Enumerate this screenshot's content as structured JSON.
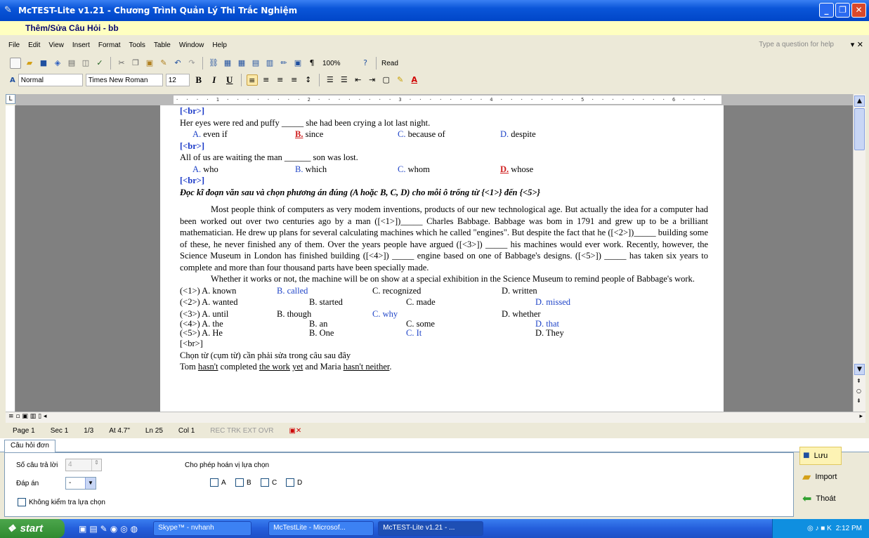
{
  "window": {
    "title": "McTEST-Lite v1.21 - Chương Trình Quản Lý Thi Trắc Nghiệm",
    "subheader": "Thêm/Sửa Câu Hỏi - bb"
  },
  "menu": [
    "File",
    "Edit",
    "View",
    "Insert",
    "Format",
    "Tools",
    "Table",
    "Window",
    "Help"
  ],
  "help_box": "Type a question for help",
  "toolbar": {
    "zoom": "100%",
    "read": "Read",
    "style": "Normal",
    "font": "Times New Roman",
    "size": "12"
  },
  "doc": {
    "br": "[<br>]",
    "q1_stem": "Her eyes were red and puffy _____ she had been crying a lot last night.",
    "q1_opts": [
      [
        "A.",
        "even if"
      ],
      [
        "B.",
        "since"
      ],
      [
        "C.",
        "because of"
      ],
      [
        "D.",
        "despite"
      ]
    ],
    "q2_stem": "All of us are waiting the man ______ son was lost.",
    "q2_opts": [
      [
        "A.",
        "who"
      ],
      [
        "B.",
        "which"
      ],
      [
        "C.",
        "whom"
      ],
      [
        "D.",
        "whose"
      ]
    ],
    "instruction": "Đọc kĩ đoạn văn sau và chọn phương án đúng  (A hoặc B, C, D) cho mỗi ô trống từ {<1>} đến {<5>}",
    "para1": "Most people think of computers as very modem inventions, products of our new technological age. But actually the idea for a computer had been worked out over two centuries ago by a man ([<1>])_____ Charles Babbage. Babbage was bom in 1791 and grew up to be a brilliant mathematician. He drew up plans for several calculating machines which he called \"engines\". But despite the fact that he ([<2>])_____ building some of these, he never finished any of them. Over the years people have argued ([<3>]) _____ his machines would ever work. Recently, however, the Science Museum in London has finished building ([<4>]) _____ engine based on one of Babbage's designs. ([<5>]) _____ has taken six years to complete and more than four thousand parts have been specially made.",
    "para2": "Whether it works or not, the machine will be on show at a special exhibition in the Science Museum to remind people of Babbage's work.",
    "ans": [
      [
        "(<1>) A. known",
        "B. called",
        "C. recognized",
        "D. written"
      ],
      [
        "(<2>) A. wanted",
        "B. started",
        "C. made",
        "D. missed"
      ],
      [
        "(<3>) A. until",
        "B. though",
        "C. why",
        "D. whether"
      ],
      [
        "(<4>) A. the",
        "B. an",
        "C. some",
        "D. that"
      ],
      [
        "(<5>) A. He",
        "B. One",
        "C. It",
        "D. They"
      ]
    ],
    "br2": "[<br>]",
    "last_instr": "Chọn từ (cụm từ) cần phải sửa trong câu sau đây",
    "last_parts": [
      "Tom ",
      "hasn't",
      " completed ",
      "the work",
      " ",
      "yet",
      " and Maria ",
      "hasn't neither",
      "."
    ]
  },
  "status": {
    "page": "Page 1",
    "sec": "Sec 1",
    "pages": "1/3",
    "at": "At 4.7\"",
    "ln": "Ln 25",
    "col": "Col 1",
    "modes": "REC  TRK  EXT  OVR"
  },
  "panel": {
    "tab": "Câu hỏi đơn",
    "num_answers_label": "Số câu trả lời",
    "num_answers": "4",
    "answer_label": "Đáp án",
    "answer_value": "-",
    "no_check_label": "Không kiểm tra lựa chọn",
    "shuffle_label": "Cho phép hoán vị lựa chọn",
    "shuffle_opts": [
      "A",
      "B",
      "C",
      "D"
    ]
  },
  "buttons": {
    "save": "Lưu",
    "import": "Import",
    "exit": "Thoát"
  },
  "taskbar": {
    "start": "start",
    "tasks": [
      "Skype™ - nvhanh",
      "McTestLite - Microsof...",
      "McTEST-Lite v1.21 - ..."
    ],
    "time": "2:12 PM"
  }
}
